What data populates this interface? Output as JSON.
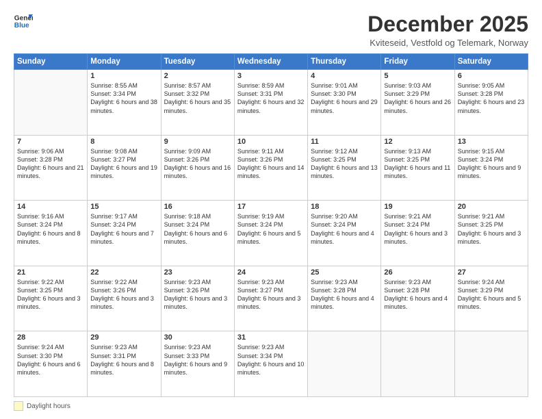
{
  "header": {
    "logo_line1": "General",
    "logo_line2": "Blue",
    "month_title": "December 2025",
    "subtitle": "Kviteseid, Vestfold og Telemark, Norway"
  },
  "weekdays": [
    "Sunday",
    "Monday",
    "Tuesday",
    "Wednesday",
    "Thursday",
    "Friday",
    "Saturday"
  ],
  "legend": {
    "daylight_label": "Daylight hours"
  },
  "weeks": [
    [
      {
        "day": "",
        "sunrise": "",
        "sunset": "",
        "daylight": ""
      },
      {
        "day": "1",
        "sunrise": "Sunrise: 8:55 AM",
        "sunset": "Sunset: 3:34 PM",
        "daylight": "Daylight: 6 hours and 38 minutes."
      },
      {
        "day": "2",
        "sunrise": "Sunrise: 8:57 AM",
        "sunset": "Sunset: 3:32 PM",
        "daylight": "Daylight: 6 hours and 35 minutes."
      },
      {
        "day": "3",
        "sunrise": "Sunrise: 8:59 AM",
        "sunset": "Sunset: 3:31 PM",
        "daylight": "Daylight: 6 hours and 32 minutes."
      },
      {
        "day": "4",
        "sunrise": "Sunrise: 9:01 AM",
        "sunset": "Sunset: 3:30 PM",
        "daylight": "Daylight: 6 hours and 29 minutes."
      },
      {
        "day": "5",
        "sunrise": "Sunrise: 9:03 AM",
        "sunset": "Sunset: 3:29 PM",
        "daylight": "Daylight: 6 hours and 26 minutes."
      },
      {
        "day": "6",
        "sunrise": "Sunrise: 9:05 AM",
        "sunset": "Sunset: 3:28 PM",
        "daylight": "Daylight: 6 hours and 23 minutes."
      }
    ],
    [
      {
        "day": "7",
        "sunrise": "Sunrise: 9:06 AM",
        "sunset": "Sunset: 3:28 PM",
        "daylight": "Daylight: 6 hours and 21 minutes."
      },
      {
        "day": "8",
        "sunrise": "Sunrise: 9:08 AM",
        "sunset": "Sunset: 3:27 PM",
        "daylight": "Daylight: 6 hours and 19 minutes."
      },
      {
        "day": "9",
        "sunrise": "Sunrise: 9:09 AM",
        "sunset": "Sunset: 3:26 PM",
        "daylight": "Daylight: 6 hours and 16 minutes."
      },
      {
        "day": "10",
        "sunrise": "Sunrise: 9:11 AM",
        "sunset": "Sunset: 3:26 PM",
        "daylight": "Daylight: 6 hours and 14 minutes."
      },
      {
        "day": "11",
        "sunrise": "Sunrise: 9:12 AM",
        "sunset": "Sunset: 3:25 PM",
        "daylight": "Daylight: 6 hours and 13 minutes."
      },
      {
        "day": "12",
        "sunrise": "Sunrise: 9:13 AM",
        "sunset": "Sunset: 3:25 PM",
        "daylight": "Daylight: 6 hours and 11 minutes."
      },
      {
        "day": "13",
        "sunrise": "Sunrise: 9:15 AM",
        "sunset": "Sunset: 3:24 PM",
        "daylight": "Daylight: 6 hours and 9 minutes."
      }
    ],
    [
      {
        "day": "14",
        "sunrise": "Sunrise: 9:16 AM",
        "sunset": "Sunset: 3:24 PM",
        "daylight": "Daylight: 6 hours and 8 minutes."
      },
      {
        "day": "15",
        "sunrise": "Sunrise: 9:17 AM",
        "sunset": "Sunset: 3:24 PM",
        "daylight": "Daylight: 6 hours and 7 minutes."
      },
      {
        "day": "16",
        "sunrise": "Sunrise: 9:18 AM",
        "sunset": "Sunset: 3:24 PM",
        "daylight": "Daylight: 6 hours and 6 minutes."
      },
      {
        "day": "17",
        "sunrise": "Sunrise: 9:19 AM",
        "sunset": "Sunset: 3:24 PM",
        "daylight": "Daylight: 6 hours and 5 minutes."
      },
      {
        "day": "18",
        "sunrise": "Sunrise: 9:20 AM",
        "sunset": "Sunset: 3:24 PM",
        "daylight": "Daylight: 6 hours and 4 minutes."
      },
      {
        "day": "19",
        "sunrise": "Sunrise: 9:21 AM",
        "sunset": "Sunset: 3:24 PM",
        "daylight": "Daylight: 6 hours and 3 minutes."
      },
      {
        "day": "20",
        "sunrise": "Sunrise: 9:21 AM",
        "sunset": "Sunset: 3:25 PM",
        "daylight": "Daylight: 6 hours and 3 minutes."
      }
    ],
    [
      {
        "day": "21",
        "sunrise": "Sunrise: 9:22 AM",
        "sunset": "Sunset: 3:25 PM",
        "daylight": "Daylight: 6 hours and 3 minutes."
      },
      {
        "day": "22",
        "sunrise": "Sunrise: 9:22 AM",
        "sunset": "Sunset: 3:26 PM",
        "daylight": "Daylight: 6 hours and 3 minutes."
      },
      {
        "day": "23",
        "sunrise": "Sunrise: 9:23 AM",
        "sunset": "Sunset: 3:26 PM",
        "daylight": "Daylight: 6 hours and 3 minutes."
      },
      {
        "day": "24",
        "sunrise": "Sunrise: 9:23 AM",
        "sunset": "Sunset: 3:27 PM",
        "daylight": "Daylight: 6 hours and 3 minutes."
      },
      {
        "day": "25",
        "sunrise": "Sunrise: 9:23 AM",
        "sunset": "Sunset: 3:28 PM",
        "daylight": "Daylight: 6 hours and 4 minutes."
      },
      {
        "day": "26",
        "sunrise": "Sunrise: 9:23 AM",
        "sunset": "Sunset: 3:28 PM",
        "daylight": "Daylight: 6 hours and 4 minutes."
      },
      {
        "day": "27",
        "sunrise": "Sunrise: 9:24 AM",
        "sunset": "Sunset: 3:29 PM",
        "daylight": "Daylight: 6 hours and 5 minutes."
      }
    ],
    [
      {
        "day": "28",
        "sunrise": "Sunrise: 9:24 AM",
        "sunset": "Sunset: 3:30 PM",
        "daylight": "Daylight: 6 hours and 6 minutes."
      },
      {
        "day": "29",
        "sunrise": "Sunrise: 9:23 AM",
        "sunset": "Sunset: 3:31 PM",
        "daylight": "Daylight: 6 hours and 8 minutes."
      },
      {
        "day": "30",
        "sunrise": "Sunrise: 9:23 AM",
        "sunset": "Sunset: 3:33 PM",
        "daylight": "Daylight: 6 hours and 9 minutes."
      },
      {
        "day": "31",
        "sunrise": "Sunrise: 9:23 AM",
        "sunset": "Sunset: 3:34 PM",
        "daylight": "Daylight: 6 hours and 10 minutes."
      },
      {
        "day": "",
        "sunrise": "",
        "sunset": "",
        "daylight": ""
      },
      {
        "day": "",
        "sunrise": "",
        "sunset": "",
        "daylight": ""
      },
      {
        "day": "",
        "sunrise": "",
        "sunset": "",
        "daylight": ""
      }
    ]
  ]
}
